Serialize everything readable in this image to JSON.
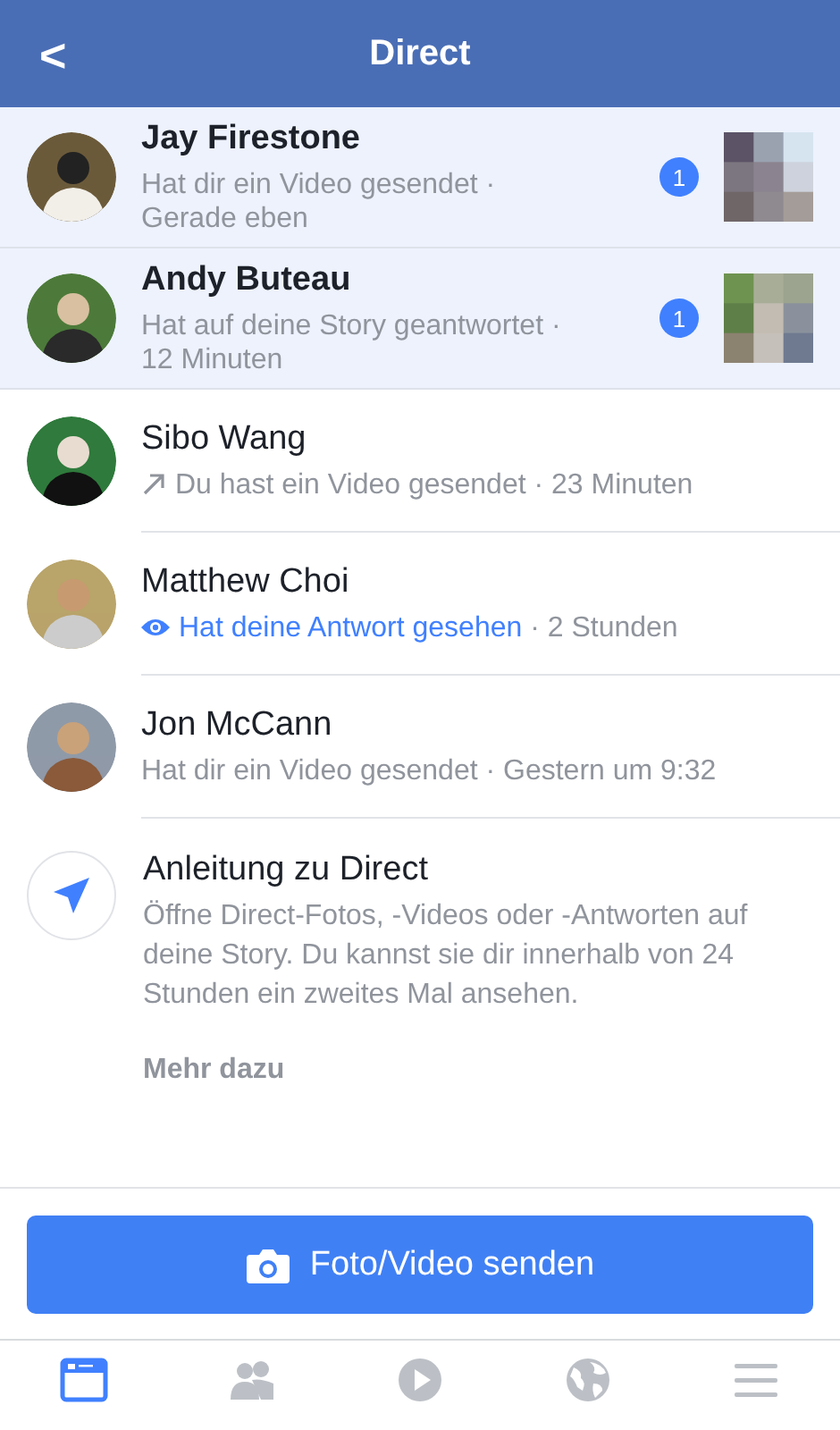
{
  "header": {
    "back": "<",
    "title": "Direct"
  },
  "conversations": [
    {
      "name": "Jay Firestone",
      "kind": "received",
      "preview": "Hat dir ein Video gesendet · Gerade eben",
      "unread": true,
      "count": "1"
    },
    {
      "name": "Andy Buteau",
      "kind": "received",
      "preview": "Hat auf deine Story geantwortet · 12 Minuten",
      "unread": true,
      "count": "1"
    },
    {
      "name": "Sibo Wang",
      "kind": "sent",
      "preview": "Du hast ein Video gesendet · 23 Minuten",
      "unread": false
    },
    {
      "name": "Matthew Choi",
      "kind": "seen",
      "status": "Hat deine Antwort gesehen",
      "preview": "· 2 Stunden",
      "unread": false
    },
    {
      "name": "Jon McCann",
      "kind": "received",
      "preview": "Hat dir ein Video gesendet · Gestern um 9:32",
      "unread": false
    }
  ],
  "tutorial": {
    "title": "Anleitung zu Direct",
    "body": "Öffne Direct-Fotos, -Videos oder -Antworten auf deine Story. Du kannst sie dir innerhalb von 24 Stunden ein zweites Mal ansehen.",
    "link": "Mehr dazu"
  },
  "send_button": "Foto/Video senden",
  "tabs": [
    {
      "selected": true
    },
    {
      "selected": false
    },
    {
      "selected": false
    },
    {
      "selected": false
    },
    {
      "selected": false
    }
  ]
}
